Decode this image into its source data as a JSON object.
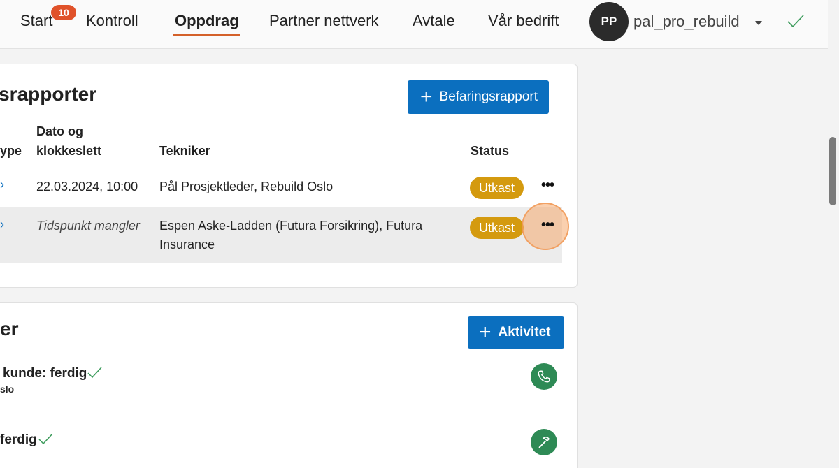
{
  "nav": {
    "items": [
      {
        "label": "Start",
        "badge": "10"
      },
      {
        "label": "Kontroll"
      },
      {
        "label": "Oppdrag",
        "active": true
      },
      {
        "label": "Partner nettverk"
      },
      {
        "label": "Avtale"
      },
      {
        "label": "Vår bedrift"
      }
    ],
    "user": {
      "initials": "PP",
      "name": "pal_pro_rebuild"
    }
  },
  "reports": {
    "title": "gsrapporter",
    "add_button": "Befaringsrapport",
    "columns": [
      "ype",
      "Dato og klokkeslett",
      "Tekniker",
      "Status"
    ],
    "rows": [
      {
        "date": "22.03.2024, 10:00",
        "technician": "Pål Prosjektleder, Rebuild Oslo",
        "status": "Utkast",
        "date_missing": false
      },
      {
        "date": "Tidspunkt mangler",
        "technician": "Espen Aske-Ladden (Futura Forsikring), Futura Insurance",
        "status": "Utkast",
        "date_missing": true
      }
    ]
  },
  "activities": {
    "title": "er",
    "add_button": "Aktivitet",
    "items": [
      {
        "title": "kunde: ferdig",
        "subtitle": "slo",
        "icon": "phone-icon"
      },
      {
        "title": "ferdig",
        "subtitle": "",
        "icon": "hammer-icon"
      }
    ]
  },
  "colors": {
    "accent": "#0b6fbf",
    "status_draft": "#d49a0f",
    "badge": "#e0522a",
    "success": "#2e8a55"
  }
}
